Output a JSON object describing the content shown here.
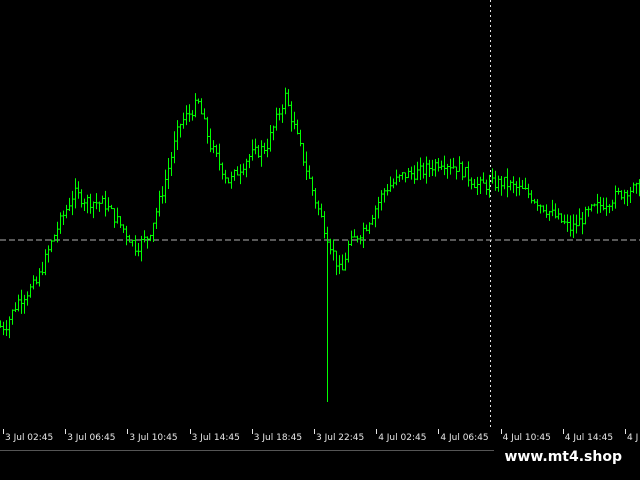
{
  "chart_data": {
    "type": "bar",
    "bar_style": "ohlc",
    "title": "",
    "xlabel": "",
    "ylabel": "",
    "grid": false,
    "background": "#000000",
    "bar_color": "#00ff00",
    "price_line": {
      "value": 0.5,
      "color": "#b0b0b0",
      "style": "dashed"
    },
    "crosshair": {
      "time_index": 7.5,
      "color": "#e0e0e0",
      "style": "dotted"
    },
    "price_path": [
      [
        0,
        0.26
      ],
      [
        0.2,
        0.33
      ],
      [
        0.5,
        0.38
      ],
      [
        0.8,
        0.52
      ],
      [
        1.1,
        0.63
      ],
      [
        1.3,
        0.61
      ],
      [
        1.6,
        0.6
      ],
      [
        1.9,
        0.53
      ],
      [
        2.1,
        0.48
      ],
      [
        2.3,
        0.51
      ],
      [
        2.5,
        0.62
      ],
      [
        2.8,
        0.82
      ],
      [
        3.1,
        0.88
      ],
      [
        3.3,
        0.76
      ],
      [
        3.6,
        0.66
      ],
      [
        3.9,
        0.73
      ],
      [
        4.2,
        0.76
      ],
      [
        4.5,
        0.9
      ],
      [
        4.7,
        0.78
      ],
      [
        5.0,
        0.6
      ],
      [
        5.2,
        0.5
      ],
      [
        5.4,
        0.4
      ],
      [
        5.5,
        0.48
      ],
      [
        5.8,
        0.54
      ],
      [
        6.1,
        0.64
      ],
      [
        6.4,
        0.68
      ],
      [
        6.7,
        0.69
      ],
      [
        7.0,
        0.72
      ],
      [
        7.3,
        0.7
      ],
      [
        7.6,
        0.65
      ],
      [
        8.0,
        0.66
      ],
      [
        8.4,
        0.63
      ],
      [
        8.8,
        0.57
      ],
      [
        9.1,
        0.53
      ],
      [
        9.4,
        0.58
      ],
      [
        9.7,
        0.61
      ],
      [
        10.0,
        0.64
      ],
      [
        10.3,
        0.64
      ],
      [
        10.6,
        0.61
      ],
      [
        10.9,
        0.55
      ],
      [
        11.2,
        0.49
      ],
      [
        11.5,
        0.52
      ],
      [
        11.8,
        0.46
      ],
      [
        12.1,
        0.4
      ],
      [
        12.4,
        0.36
      ],
      [
        12.7,
        0.41
      ],
      [
        13.0,
        0.45
      ],
      [
        13.3,
        0.43
      ],
      [
        13.6,
        0.39
      ],
      [
        13.9,
        0.34
      ],
      [
        14.2,
        0.3
      ],
      [
        14.6,
        0.26
      ],
      [
        14.9,
        0.38
      ],
      [
        15.1,
        0.45
      ],
      [
        15.4,
        0.52
      ]
    ],
    "spikes": [
      {
        "t": 5.2,
        "low": 0.05
      }
    ],
    "x_labels": [
      "3 Jul 02:45",
      "3 Jul 06:45",
      "3 Jul 10:45",
      "3 Jul 14:45",
      "3 Jul 18:45",
      "3 Jul 22:45",
      "4 Jul 02:45",
      "4 Jul 06:45",
      "4 Jul 10:45",
      "4 Jul 14:45",
      "4 J"
    ]
  },
  "watermark": {
    "text": "www.mt4.shop"
  }
}
